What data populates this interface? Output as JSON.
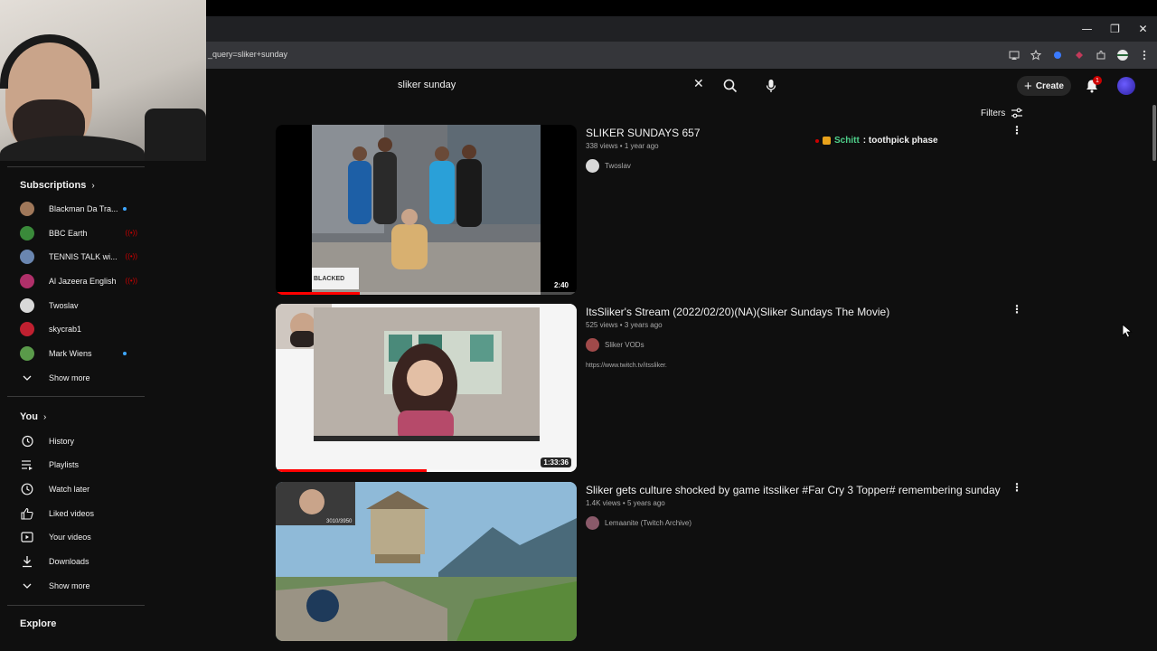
{
  "browser": {
    "url_fragment": "_query=sliker+sunday",
    "window_buttons": [
      "—",
      "❐",
      "✕"
    ],
    "extension_icons": [
      "cast-icon",
      "star-icon",
      "extension-a-icon",
      "extension-b-icon",
      "puzzle-icon",
      "profile-icon",
      "menu-icon"
    ]
  },
  "masthead": {
    "search_value": "sliker sunday",
    "clear_glyph": "✕",
    "create_label": "Create",
    "create_glyph": "+",
    "notification_count": "1"
  },
  "filters_label": "Filters",
  "sidebar": {
    "subscriptions_heading": "Subscriptions",
    "heading_chevron": "›",
    "subscriptions": [
      {
        "label": "Blackman Da Tra...",
        "avatar_color": "#a0785a",
        "indicator": "dot"
      },
      {
        "label": "BBC Earth",
        "avatar_color": "#3a8a3a",
        "indicator": "live"
      },
      {
        "label": "TENNIS TALK wi...",
        "avatar_color": "#6a86b0",
        "indicator": "live"
      },
      {
        "label": "Al Jazeera English",
        "avatar_color": "#b0306a",
        "indicator": "live"
      },
      {
        "label": "Twoslav",
        "avatar_color": "#d8d8d8",
        "indicator": "none"
      },
      {
        "label": "skycrab1",
        "avatar_color": "#c02030",
        "indicator": "none"
      },
      {
        "label": "Mark Wiens",
        "avatar_color": "#5a9a4a",
        "indicator": "dot"
      }
    ],
    "show_more_label": "Show more",
    "live_glyph": "((•))",
    "you_heading": "You",
    "you_items": [
      {
        "label": "History",
        "icon": "history-icon"
      },
      {
        "label": "Playlists",
        "icon": "playlists-icon"
      },
      {
        "label": "Watch later",
        "icon": "watch-later-icon"
      },
      {
        "label": "Liked videos",
        "icon": "like-icon"
      },
      {
        "label": "Your videos",
        "icon": "your-videos-icon"
      },
      {
        "label": "Downloads",
        "icon": "download-icon"
      }
    ],
    "show_more_label_2": "Show more",
    "explore_heading": "Explore"
  },
  "results": [
    {
      "title": "SLIKER SUNDAYS 657",
      "views": "338 views",
      "age": "1 year ago",
      "channel": "Twoslav",
      "duration": "2:40",
      "watch_progress": 0.28,
      "thumb_watermark": "BLACKED",
      "chat_user": "Schitt",
      "chat_message": ": toothpick phase"
    },
    {
      "title": "ItsSliker's Stream (2022/02/20)(NA)(Sliker Sundays The Movie)",
      "views": "525 views",
      "age": "3 years ago",
      "channel": "Sliker VODs",
      "description": "https://www.twitch.tv/itssliker.",
      "duration": "1:33:36",
      "watch_progress": 0.5
    },
    {
      "title": "Sliker gets culture shocked by game itssliker #Far Cry 3 Topper# remembering sunday",
      "views": "1.4K views",
      "age": "5 years ago",
      "channel": "Lemaanite (Twitch Archive)",
      "thumb_overlay": "3010/3950"
    }
  ],
  "meta_separator": " • ",
  "kebab_glyph": "⋮"
}
